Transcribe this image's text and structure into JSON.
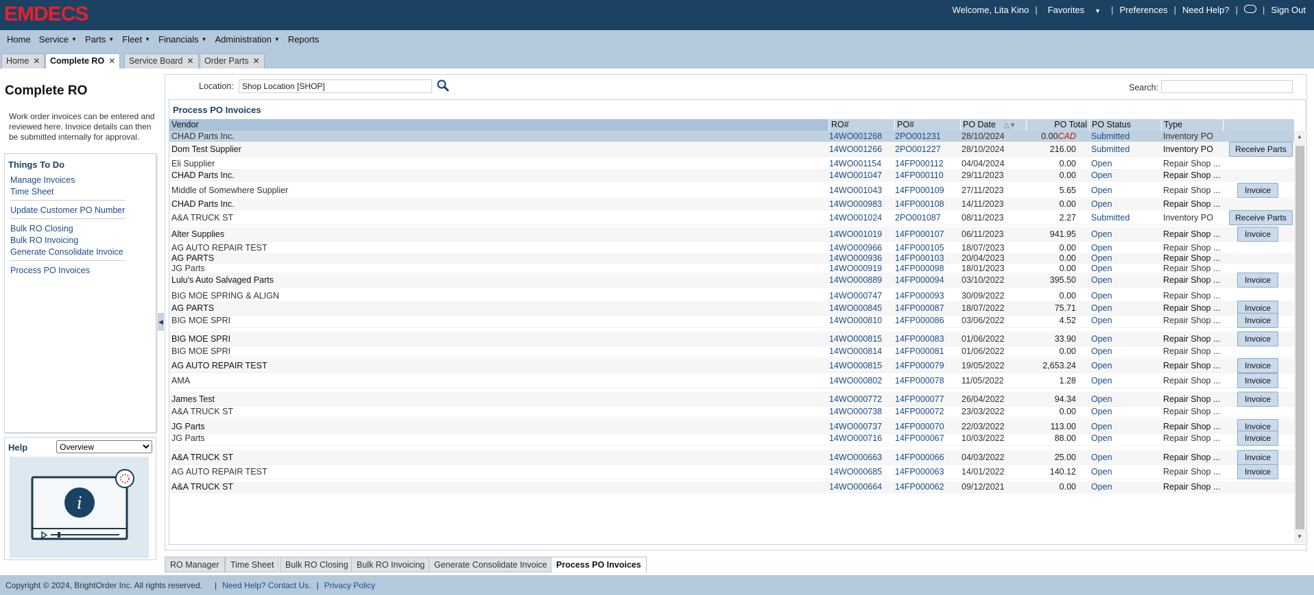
{
  "brand": {
    "logo": "EMDECS"
  },
  "topnav": {
    "welcome": "Welcome, Lita Kino",
    "favorites": "Favorites",
    "preferences": "Preferences",
    "need_help": "Need Help?",
    "sign_out": "Sign Out"
  },
  "menu": {
    "home": "Home",
    "service": "Service",
    "parts": "Parts",
    "fleet": "Fleet",
    "financials": "Financials",
    "administration": "Administration",
    "reports": "Reports"
  },
  "tabs": [
    {
      "label": "Home"
    },
    {
      "label": "Complete RO"
    },
    {
      "label": "Service Board"
    },
    {
      "label": "Order Parts"
    }
  ],
  "left": {
    "title": "Complete RO",
    "intro": "Work order invoices can be entered and reviewed here. Invoice details can then be submitted internally for approval.",
    "todo_title": "Things To Do",
    "links": [
      "Manage Invoices",
      "Time Sheet",
      "Update Customer PO Number",
      "Bulk RO Closing",
      "Bulk RO Invoicing",
      "Generate Consolidate Invoice",
      "Process PO Invoices"
    ],
    "help_title": "Help",
    "help_option": "Overview"
  },
  "filters": {
    "location_label": "Location:",
    "location_value": "Shop Location [SHOP]",
    "search_label": "Search:",
    "search_value": ""
  },
  "grid": {
    "title": "Process PO Invoices",
    "columns": {
      "vendor": "Vendor",
      "ro": "RO#",
      "po": "PO#",
      "date": "PO Date",
      "total": "PO Total",
      "status": "PO Status",
      "type": "Type"
    },
    "rows": [
      {
        "vendor": "CHAD Parts Inc.",
        "ro": "14WO001268",
        "po": "2PO001231",
        "date": "28/10/2024",
        "total": "0.00",
        "cur": "CAD",
        "status": "Submitted",
        "type": "Inventory PO",
        "btn": ""
      },
      {
        "vendor": "Dom Test Supplier",
        "ro": "14WO001266",
        "po": "2PO001227",
        "date": "28/10/2024",
        "total": "216.00",
        "cur": "",
        "status": "Submitted",
        "type": "Inventory PO",
        "btn": "Receive Parts"
      },
      {
        "vendor": "Eli Supplier",
        "ro": "14WO001154",
        "po": "14FP000112",
        "date": "04/04/2024",
        "total": "0.00",
        "cur": "",
        "status": "Open",
        "type": "Repair Shop ...",
        "btn": ""
      },
      {
        "vendor": "CHAD Parts Inc.",
        "ro": "14WO001047",
        "po": "14FP000110",
        "date": "29/11/2023",
        "total": "0.00",
        "cur": "",
        "status": "Open",
        "type": "Repair Shop ...",
        "btn": ""
      },
      {
        "vendor": "Middle of Somewhere Supplier",
        "ro": "14WO001043",
        "po": "14FP000109",
        "date": "27/11/2023",
        "total": "5.65",
        "cur": "",
        "status": "Open",
        "type": "Repair Shop ...",
        "btn": "Invoice"
      },
      {
        "vendor": "CHAD Parts Inc.",
        "ro": "14WO000983",
        "po": "14FP000108",
        "date": "14/11/2023",
        "total": "0.00",
        "cur": "",
        "status": "Open",
        "type": "Repair Shop ...",
        "btn": ""
      },
      {
        "vendor": "A&A TRUCK ST",
        "ro": "14WO001024",
        "po": "2PO001087",
        "date": "08/11/2023",
        "total": "2.27",
        "cur": "",
        "status": "Submitted",
        "type": "Inventory PO",
        "btn": "Receive Parts"
      },
      {
        "vendor": "Alter Supplies",
        "ro": "14WO001019",
        "po": "14FP000107",
        "date": "06/11/2023",
        "total": "941.95",
        "cur": "",
        "status": "Open",
        "type": "Repair Shop ...",
        "btn": "Invoice"
      },
      {
        "vendor": "AG AUTO REPAIR TEST",
        "ro": "14WO000966",
        "po": "14FP000105",
        "date": "18/07/2023",
        "total": "0.00",
        "cur": "",
        "status": "Open",
        "type": "Repair Shop ...",
        "btn": ""
      },
      {
        "vendor": "AG PARTS",
        "ro": "14WO000936",
        "po": "14FP000103",
        "date": "20/04/2023",
        "total": "0.00",
        "cur": "",
        "status": "Open",
        "type": "Repair Shop ...",
        "btn": ""
      },
      {
        "vendor": "JG Parts",
        "ro": "14WO000919",
        "po": "14FP000098",
        "date": "18/01/2023",
        "total": "0.00",
        "cur": "",
        "status": "Open",
        "type": "Repair Shop ...",
        "btn": ""
      },
      {
        "vendor": "Lulu's Auto Salvaged Parts",
        "ro": "14WO000889",
        "po": "14FP000094",
        "date": "03/10/2022",
        "total": "395.50",
        "cur": "",
        "status": "Open",
        "type": "Repair Shop ...",
        "btn": "Invoice"
      },
      {
        "vendor": "BIG MOE SPRING & ALIGN",
        "ro": "14WO000747",
        "po": "14FP000093",
        "date": "30/09/2022",
        "total": "0.00",
        "cur": "",
        "status": "Open",
        "type": "Repair Shop ...",
        "btn": ""
      },
      {
        "vendor": "AG PARTS",
        "ro": "14WO000845",
        "po": "14FP000087",
        "date": "18/07/2022",
        "total": "75.71",
        "cur": "",
        "status": "Open",
        "type": "Repair Shop ...",
        "btn": "Invoice"
      },
      {
        "vendor": "BIG MOE SPRI",
        "ro": "14WO000810",
        "po": "14FP000086",
        "date": "03/06/2022",
        "total": "4.52",
        "cur": "",
        "status": "Open",
        "type": "Repair Shop ...",
        "btn": "Invoice"
      },
      {
        "vendor": "BIG MOE SPRI",
        "ro": "14WO000815",
        "po": "14FP000083",
        "date": "01/06/2022",
        "total": "33.90",
        "cur": "",
        "status": "Open",
        "type": "Repair Shop ...",
        "btn": "Invoice"
      },
      {
        "vendor": "BIG MOE SPRI",
        "ro": "14WO000814",
        "po": "14FP000081",
        "date": "01/06/2022",
        "total": "0.00",
        "cur": "",
        "status": "Open",
        "type": "Repair Shop ...",
        "btn": ""
      },
      {
        "vendor": "AG AUTO REPAIR TEST",
        "ro": "14WO000815",
        "po": "14FP000079",
        "date": "19/05/2022",
        "total": "2,653.24",
        "cur": "",
        "status": "Open",
        "type": "Repair Shop ...",
        "btn": "Invoice"
      },
      {
        "vendor": "AMA",
        "ro": "14WO000802",
        "po": "14FP000078",
        "date": "11/05/2022",
        "total": "1.28",
        "cur": "",
        "status": "Open",
        "type": "Repair Shop ...",
        "btn": "Invoice"
      },
      {
        "vendor": "James Test",
        "ro": "14WO000772",
        "po": "14FP000077",
        "date": "26/04/2022",
        "total": "94.34",
        "cur": "",
        "status": "Open",
        "type": "Repair Shop ...",
        "btn": "Invoice"
      },
      {
        "vendor": "A&A TRUCK ST",
        "ro": "14WO000738",
        "po": "14FP000072",
        "date": "23/03/2022",
        "total": "0.00",
        "cur": "",
        "status": "Open",
        "type": "Repair Shop ...",
        "btn": ""
      },
      {
        "vendor": "JG Parts",
        "ro": "14WO000737",
        "po": "14FP000070",
        "date": "22/03/2022",
        "total": "113.00",
        "cur": "",
        "status": "Open",
        "type": "Repair Shop ...",
        "btn": "Invoice"
      },
      {
        "vendor": "JG Parts",
        "ro": "14WO000716",
        "po": "14FP000067",
        "date": "10/03/2022",
        "total": "88.00",
        "cur": "",
        "status": "Open",
        "type": "Repair Shop ...",
        "btn": "Invoice"
      },
      {
        "vendor": "A&A TRUCK ST",
        "ro": "14WO000663",
        "po": "14FP000066",
        "date": "04/03/2022",
        "total": "25.00",
        "cur": "",
        "status": "Open",
        "type": "Repair Shop ...",
        "btn": "Invoice"
      },
      {
        "vendor": "AG AUTO REPAIR TEST",
        "ro": "14WO000685",
        "po": "14FP000063",
        "date": "14/01/2022",
        "total": "140.12",
        "cur": "",
        "status": "Open",
        "type": "Repair Shop ...",
        "btn": "Invoice"
      },
      {
        "vendor": "A&A TRUCK ST",
        "ro": "14WO000664",
        "po": "14FP000062",
        "date": "09/12/2021",
        "total": "0.00",
        "cur": "",
        "status": "Open",
        "type": "Repair Shop ...",
        "btn": ""
      }
    ]
  },
  "bottom_tabs": [
    "RO Manager",
    "Time Sheet",
    "Bulk RO Closing",
    "Bulk RO Invoicing",
    "Generate Consolidate Invoice",
    "Process PO Invoices"
  ],
  "footer": {
    "copyright": "Copyright © 2024, BrightOrder Inc. All rights reserved.",
    "help": "Need Help? Contact Us.",
    "privacy": "Privacy Policy"
  },
  "colors": {
    "topbar": "#1b4263",
    "menubar": "#b4c9dc",
    "logo": "#e8202a",
    "link": "#1a4d8a",
    "selected_row": "#bfd0e0"
  }
}
